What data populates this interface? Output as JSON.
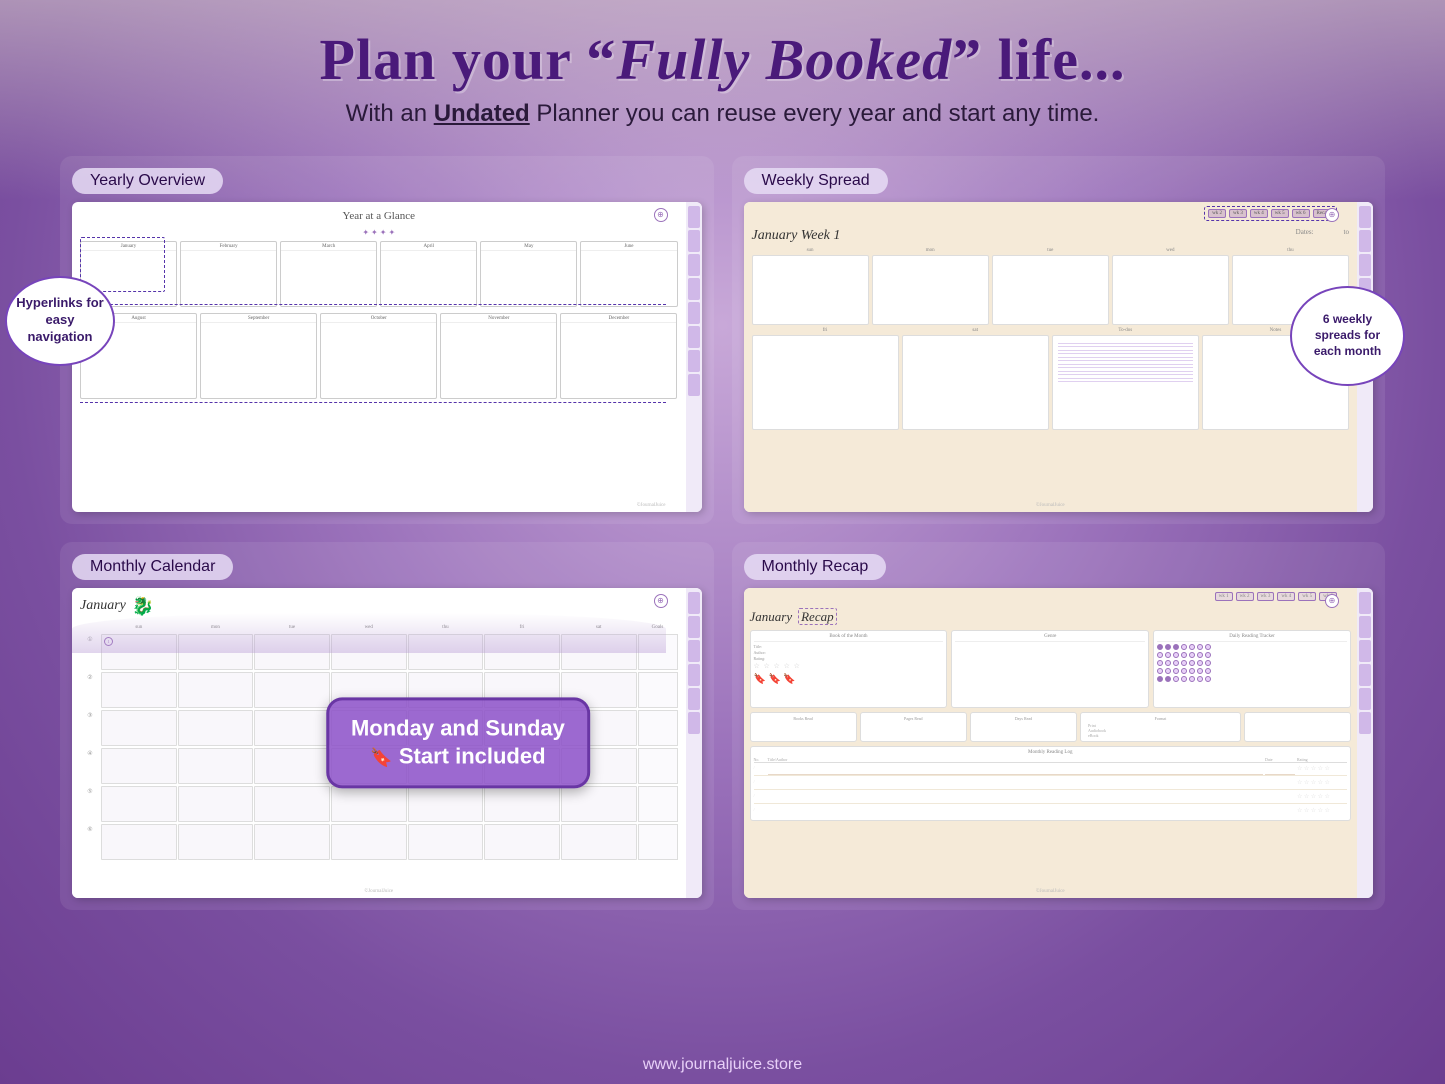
{
  "header": {
    "title_part1": "Plan your “",
    "title_italic": "Fully Booked",
    "title_part2": "” life...",
    "subtitle": "With an ",
    "subtitle_underline": "Undated",
    "subtitle_rest": " Planner you can reuse every year and start any time."
  },
  "panels": {
    "yearly": {
      "label": "Yearly Overview",
      "page_title": "Year at a Glance",
      "months_top": [
        "January",
        "February",
        "March",
        "April",
        "May",
        "June"
      ],
      "months_bottom": [
        "August",
        "September",
        "October",
        "November",
        "December"
      ],
      "hyperlinks_bubble": "Hyperlinks for easy navigation"
    },
    "weekly": {
      "label": "Weekly Spread",
      "month_week": "January Week 1",
      "dates_label": "Dates:",
      "wk_tabs": [
        "wk 2",
        "wk 3",
        "wk 4",
        "wk 5",
        "wk 6",
        "Recap"
      ],
      "days_top": [
        "sun",
        "mon",
        "tue",
        "wed",
        "thu"
      ],
      "days_bottom": [
        "fri",
        "sat",
        "To-dos",
        "Notes"
      ],
      "bubble_text": "6 weekly\nspreads for\neach month"
    },
    "monthly": {
      "label": "Monthly Calendar",
      "month_title": "January",
      "day_headers": [
        "sun",
        "mon",
        "tue",
        "wed",
        "thu",
        "fri",
        "sat"
      ],
      "goals_header": "Goals",
      "week_numbers": [
        "1",
        "2",
        "3",
        "4",
        "5",
        "6"
      ],
      "bubble_text": "Monday and Sunday\nStart included",
      "bubble_icon": "🔖"
    },
    "recap": {
      "label": "Monthly Recap",
      "title": "January",
      "recap_word": "Recap",
      "wk_tabs": [
        "wk 1",
        "wk 2",
        "wk 3",
        "wk 4",
        "wk 5",
        "wk 6"
      ],
      "book_section_title": "Book of the Month",
      "genre_title": "Genre",
      "tracker_title": "Daily Reading Tracker",
      "fields": [
        "Title:",
        "Author:",
        "Rating:"
      ],
      "stats": [
        "Books Read",
        "Pages Read",
        "Days Read",
        "Format"
      ],
      "format_items": [
        "Print",
        "Audiobook",
        "eBook"
      ],
      "log_title": "Monthly Reading Log",
      "log_cols": [
        "No.",
        "Title/Author",
        "Date",
        "Rating"
      ]
    }
  },
  "footer": {
    "website": "www.journaljuice.store"
  }
}
